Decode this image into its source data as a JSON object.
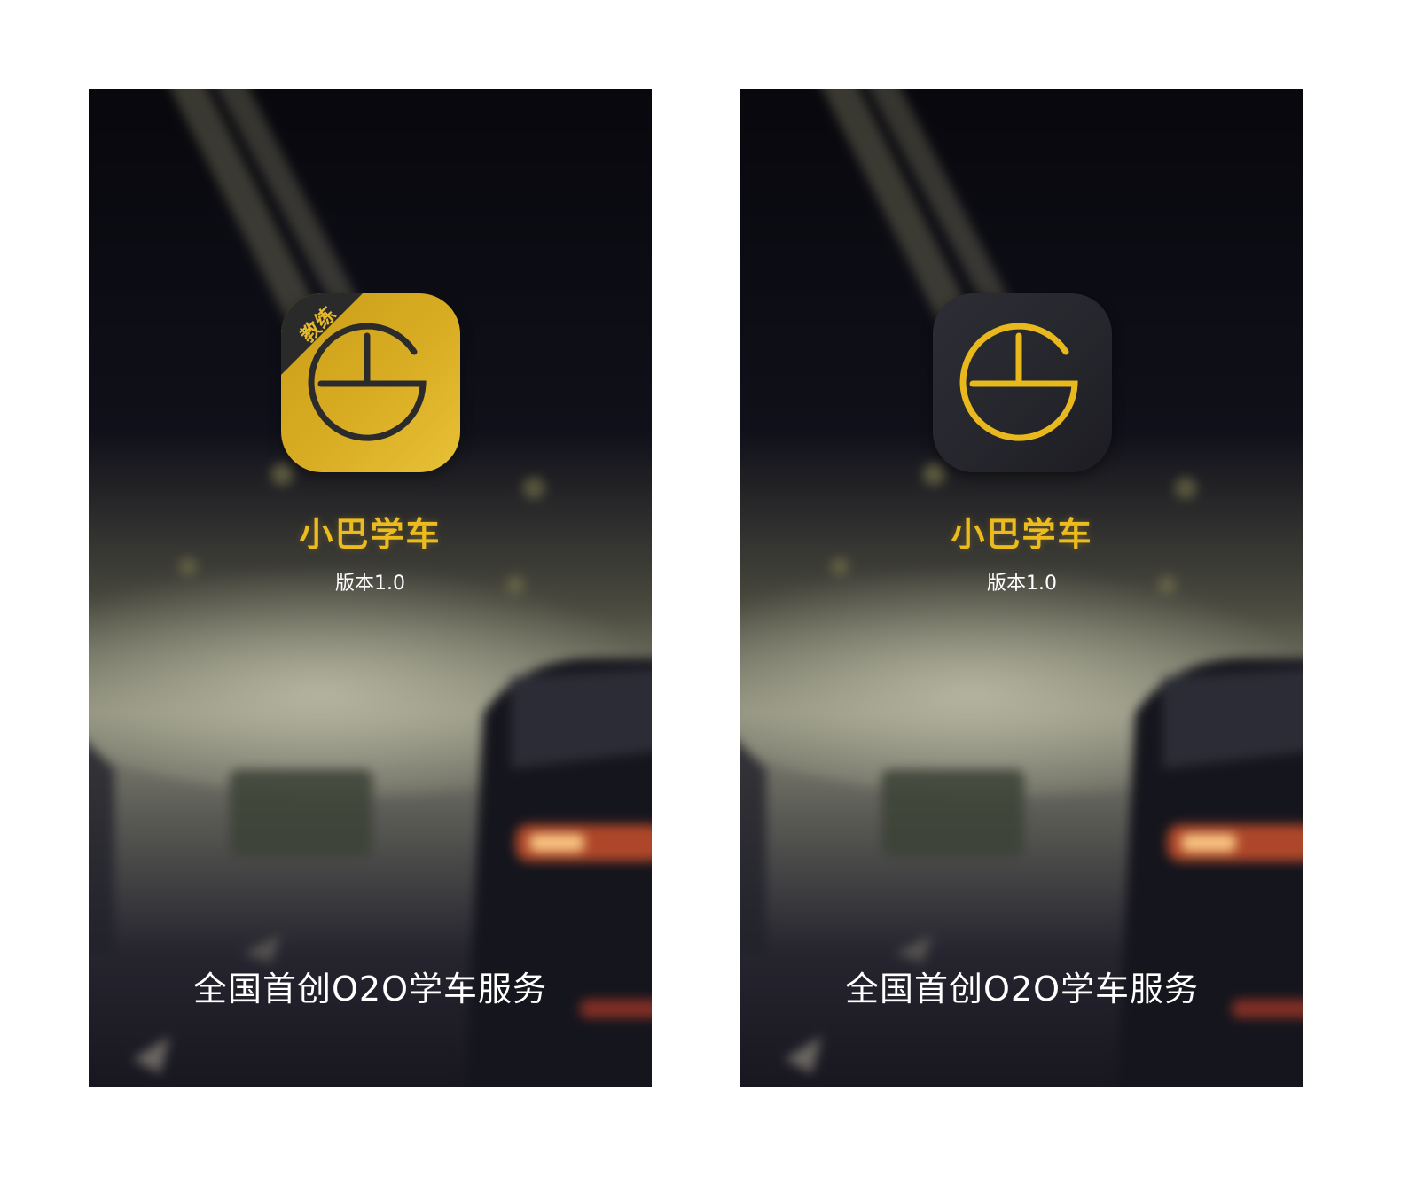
{
  "screens": [
    {
      "variant": "coach",
      "icon_badge": "教练",
      "icon_name": "bus-logo-icon",
      "app_name": "小巴学车",
      "version": "版本1.0",
      "slogan": "全国首创O2O学车服务",
      "colors": {
        "icon_bg": "#d4a820",
        "logo_stroke": "#2b2b2b",
        "badge_bg": "#2a2a2a",
        "badge_text": "#e5b92a"
      }
    },
    {
      "variant": "student",
      "icon_badge": "",
      "icon_name": "bus-logo-icon",
      "app_name": "小巴学车",
      "version": "版本1.0",
      "slogan": "全国首创O2O学车服务",
      "colors": {
        "icon_bg": "#26262d",
        "logo_stroke": "#e8b81c"
      }
    }
  ],
  "colors": {
    "accent": "#ecbb1e",
    "text": "#ffffff",
    "background": "#0b0b14"
  }
}
